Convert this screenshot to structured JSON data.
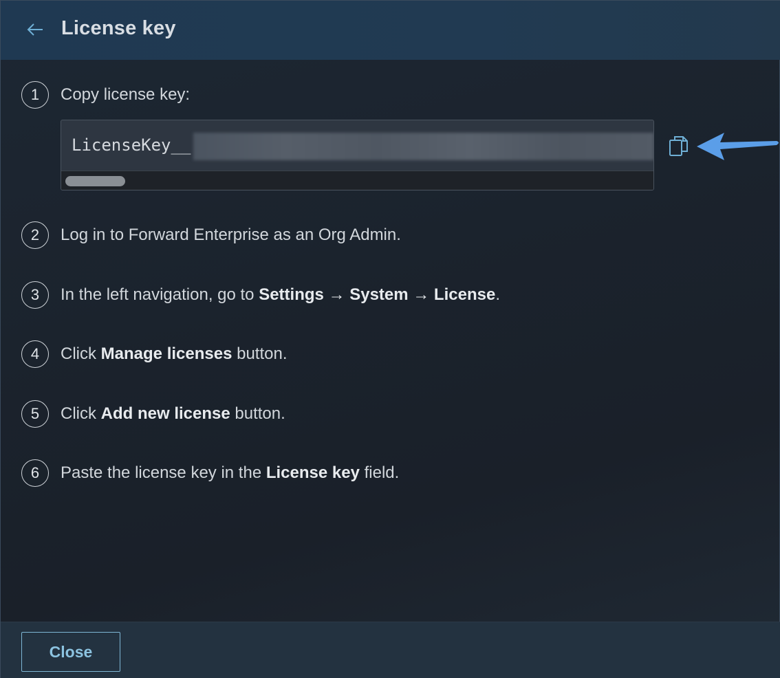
{
  "header": {
    "title": "License key",
    "back_icon": "arrow-left-icon"
  },
  "steps": [
    {
      "number": "1",
      "parts": [
        {
          "text": "Copy license key:",
          "bold": false
        }
      ]
    },
    {
      "number": "2",
      "parts": [
        {
          "text": "Log in to Forward Enterprise as an Org Admin.",
          "bold": false
        }
      ]
    },
    {
      "number": "3",
      "parts": [
        {
          "text": "In the left navigation, go to ",
          "bold": false
        },
        {
          "text": "Settings → System → License",
          "bold": true
        },
        {
          "text": ".",
          "bold": false
        }
      ]
    },
    {
      "number": "4",
      "parts": [
        {
          "text": "Click ",
          "bold": false
        },
        {
          "text": "Manage licenses",
          "bold": true
        },
        {
          "text": " button.",
          "bold": false
        }
      ]
    },
    {
      "number": "5",
      "parts": [
        {
          "text": "Click ",
          "bold": false
        },
        {
          "text": "Add new license",
          "bold": true
        },
        {
          "text": " button.",
          "bold": false
        }
      ]
    },
    {
      "number": "6",
      "parts": [
        {
          "text": "Paste the license key in the ",
          "bold": false
        },
        {
          "text": "License key",
          "bold": true
        },
        {
          "text": " field.",
          "bold": false
        }
      ]
    }
  ],
  "license_key": {
    "visible_prefix": "LicenseKey__",
    "copy_icon": "copy-icon"
  },
  "annotation": {
    "arrow_color": "#5b9ee8"
  },
  "footer": {
    "close_label": "Close"
  },
  "colors": {
    "header_bg": "#1f3952",
    "body_bg": "#1b232d",
    "accent": "#8cc3e0"
  }
}
